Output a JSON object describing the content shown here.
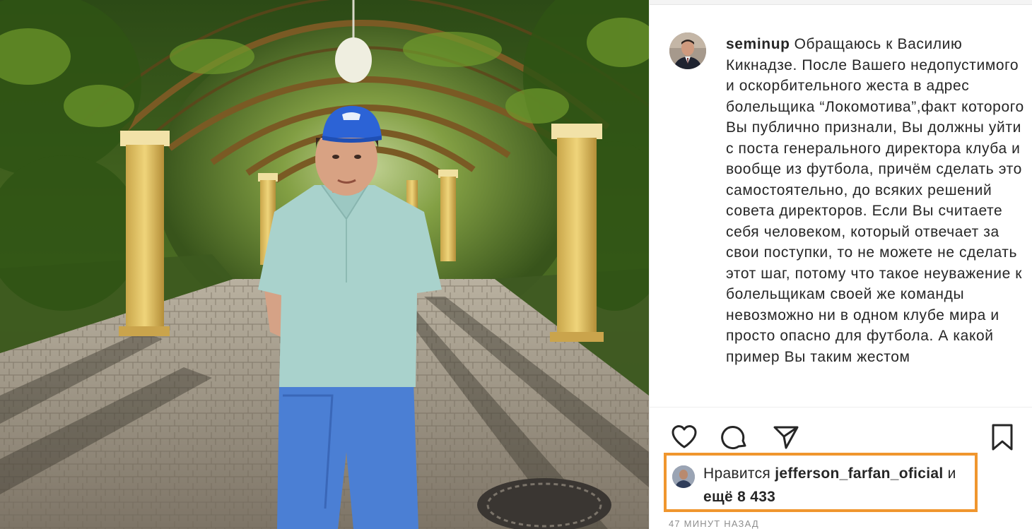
{
  "post": {
    "username": "seminup",
    "caption": "Обращаюсь к Василию Кикнадзе. После Вашего недопустимого и оскорбительного жеста в адрес болельщика “Локомотива”,факт которого Вы публично признали, Вы должны уйти с поста генерального директора клуба и вообще из футбола, причём сделать это самостоятельно, до всяких решений совета директоров. Если Вы считаете себя человеком, который отвечает за свои поступки, то не можете не сделать этот шаг, потому что такое неуважение к болельщикам своей же команды невозможно ни в одном клубе мира и просто опасно для футбола. А какой пример Вы таким жестом"
  },
  "actions": {
    "like_icon": "heart-icon",
    "comment_icon": "comment-bubble-icon",
    "share_icon": "paper-plane-icon",
    "save_icon": "bookmark-icon"
  },
  "likes": {
    "prefix": "Нравится",
    "liker_username": "jefferson_farfan_oficial",
    "connector": "и",
    "count_text": "ещё 8 433"
  },
  "timestamp": "47 МИНУТ НАЗАД",
  "colors": {
    "highlight_border": "#f0962e",
    "text": "#262626",
    "muted": "#8e8e8e"
  }
}
